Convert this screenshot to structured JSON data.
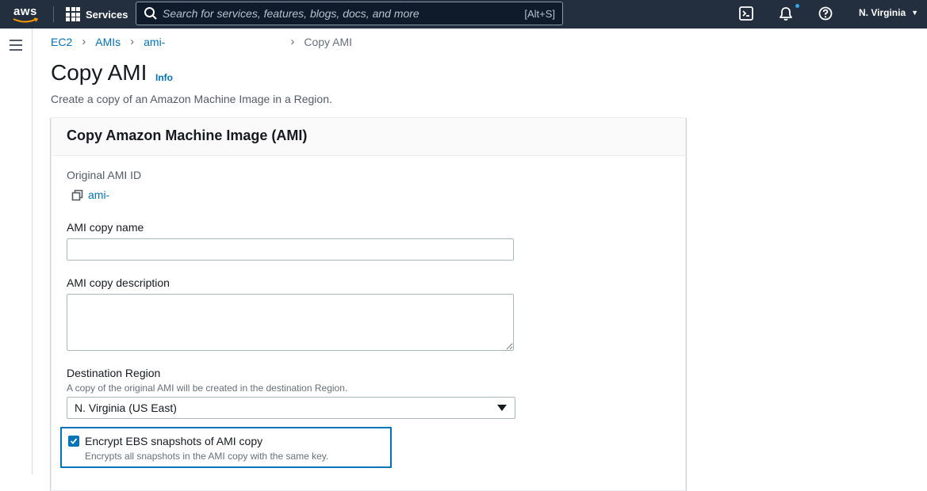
{
  "nav": {
    "logo_text": "aws",
    "services_label": "Services",
    "search_placeholder": "Search for services, features, blogs, docs, and more",
    "search_shortcut": "[Alt+S]",
    "region": "N. Virginia"
  },
  "breadcrumbs": {
    "items": [
      "EC2",
      "AMIs",
      "ami-"
    ],
    "current": "Copy AMI"
  },
  "header": {
    "title": "Copy AMI",
    "info": "Info",
    "description": "Create a copy of an Amazon Machine Image in a Region."
  },
  "panel": {
    "title": "Copy Amazon Machine Image (AMI)",
    "original_id_label": "Original AMI ID",
    "original_id_value": "ami-",
    "name_label": "AMI copy name",
    "name_value": "",
    "description_label": "AMI copy description",
    "description_value": "",
    "region_label": "Destination Region",
    "region_hint": "A copy of the original AMI will be created in the destination Region.",
    "region_value": "N. Virginia (US East)",
    "encrypt_label": "Encrypt EBS snapshots of AMI copy",
    "encrypt_hint": "Encrypts all snapshots in the AMI copy with the same key.",
    "encrypt_checked": true
  },
  "colors": {
    "nav_bg": "#232f3e",
    "link": "#0073bb",
    "logo_accent": "#ff9900",
    "notification_dot": "#2ea8e6"
  },
  "icons": [
    "grid-icon",
    "search-icon",
    "cloudshell-icon",
    "bell-icon",
    "help-icon",
    "caret-down-icon",
    "hamburger-icon",
    "copy-icon",
    "checkmark-icon"
  ]
}
